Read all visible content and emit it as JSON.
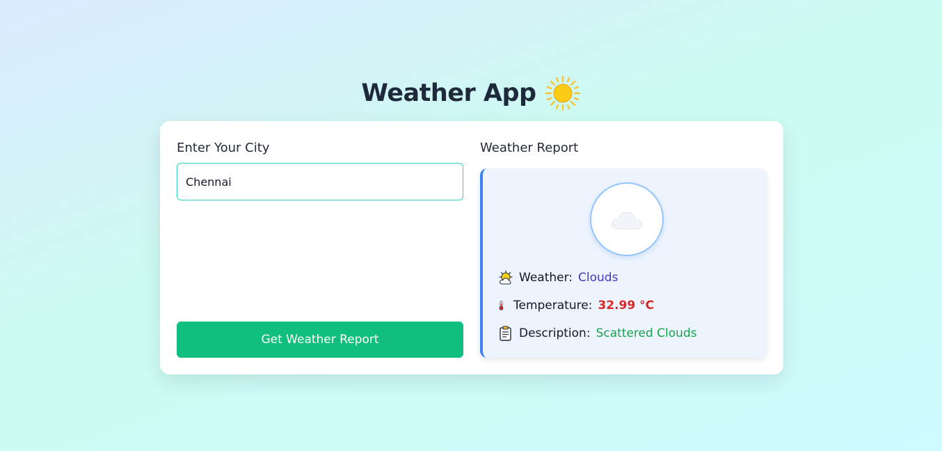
{
  "header": {
    "title": "Weather App",
    "title_icon": "sun-icon"
  },
  "form": {
    "city_label": "Enter Your City",
    "city_value": "Chennai",
    "submit_label": "Get Weather Report"
  },
  "report": {
    "heading": "Weather Report",
    "condition_icon": "cloud-icon",
    "rows": [
      {
        "icon": "sun-behind-cloud-icon",
        "label": "Weather:",
        "value": "Clouds",
        "value_color": "#4338ca"
      },
      {
        "icon": "thermometer-icon",
        "label": "Temperature:",
        "value": "32.99 °C",
        "value_color": "#dc2626"
      },
      {
        "icon": "clipboard-icon",
        "label": "Description:",
        "value": "Scattered Clouds",
        "value_color": "#16a34a"
      }
    ]
  },
  "colors": {
    "accent_button": "#10bf7d",
    "input_border": "#2dd4bf",
    "panel_accent": "#3b82f6",
    "title": "#1e293b"
  }
}
